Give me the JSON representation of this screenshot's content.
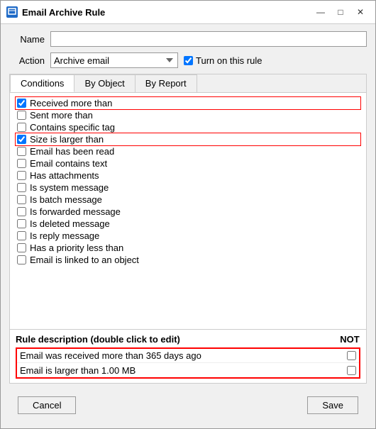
{
  "window": {
    "title": "Email Archive Rule",
    "icon": "📧",
    "controls": {
      "minimize": "—",
      "maximize": "□",
      "close": "✕"
    }
  },
  "form": {
    "name_label": "Name",
    "action_label": "Action",
    "action_value": "Archive email",
    "rule_on_label": "Turn on this rule",
    "name_placeholder": ""
  },
  "tabs": [
    {
      "id": "conditions",
      "label": "Conditions",
      "active": true
    },
    {
      "id": "by-object",
      "label": "By Object",
      "active": false
    },
    {
      "id": "by-report",
      "label": "By Report",
      "active": false
    }
  ],
  "conditions_section_label": "Conditions",
  "conditions": [
    {
      "id": "received-more-than",
      "label": "Received more than",
      "checked": true,
      "highlighted": true
    },
    {
      "id": "sent-more-than",
      "label": "Sent more than",
      "checked": false,
      "highlighted": false
    },
    {
      "id": "contains-specific-tag",
      "label": "Contains specific tag",
      "checked": false,
      "highlighted": false
    },
    {
      "id": "size-larger-than",
      "label": "Size is larger than",
      "checked": true,
      "highlighted": true
    },
    {
      "id": "email-been-read",
      "label": "Email has been read",
      "checked": false,
      "highlighted": false
    },
    {
      "id": "email-contains-text",
      "label": "Email contains text",
      "checked": false,
      "highlighted": false
    },
    {
      "id": "has-attachments",
      "label": "Has attachments",
      "checked": false,
      "highlighted": false
    },
    {
      "id": "is-system-message",
      "label": "Is system message",
      "checked": false,
      "highlighted": false
    },
    {
      "id": "is-batch-message",
      "label": "Is batch message",
      "checked": false,
      "highlighted": false
    },
    {
      "id": "is-forwarded-message",
      "label": "Is forwarded message",
      "checked": false,
      "highlighted": false
    },
    {
      "id": "is-deleted-message",
      "label": "Is deleted message",
      "checked": false,
      "highlighted": false
    },
    {
      "id": "is-reply-message",
      "label": "Is reply message",
      "checked": false,
      "highlighted": false
    },
    {
      "id": "has-priority-less-than",
      "label": "Has a priority less than",
      "checked": false,
      "highlighted": false
    },
    {
      "id": "email-linked-to-object",
      "label": "Email is linked to an object",
      "checked": false,
      "highlighted": false
    }
  ],
  "rule_description": {
    "title": "Rule description (double click to edit)",
    "not_label": "NOT",
    "rows": [
      {
        "text": "Email was received more than 365 days ago",
        "not_checked": false
      },
      {
        "text": "Email is larger than 1.00 MB",
        "not_checked": false
      }
    ]
  },
  "buttons": {
    "cancel": "Cancel",
    "save": "Save"
  }
}
